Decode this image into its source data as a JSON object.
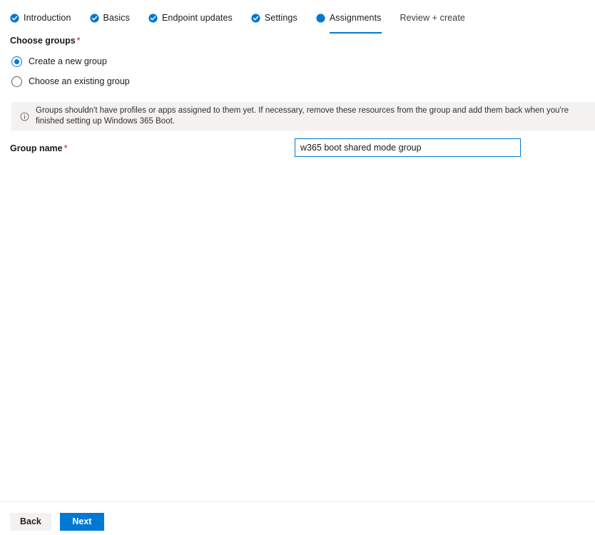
{
  "wizard": {
    "tabs": [
      {
        "label": "Introduction",
        "icon": "check-circle-icon",
        "state": "completed"
      },
      {
        "label": "Basics",
        "icon": "check-circle-icon",
        "state": "completed"
      },
      {
        "label": "Endpoint updates",
        "icon": "check-circle-icon",
        "state": "completed"
      },
      {
        "label": "Settings",
        "icon": "check-circle-icon",
        "state": "completed"
      },
      {
        "label": "Assignments",
        "icon": "filled-circle-icon",
        "state": "current"
      },
      {
        "label": "Review + create",
        "icon": "none",
        "state": "upcoming"
      }
    ]
  },
  "form": {
    "choose_groups": {
      "label": "Choose groups",
      "required_marker": "*",
      "options": [
        {
          "label": "Create a new group",
          "selected": true
        },
        {
          "label": "Choose an existing group",
          "selected": false
        }
      ]
    },
    "info_banner": {
      "icon": "info-circle-icon",
      "text": "Groups shouldn't have profiles or apps assigned to them yet. If necessary, remove these resources from the group and add them back when you're finished setting up Windows 365 Boot."
    },
    "group_name": {
      "label": "Group name",
      "required_marker": "*",
      "value": "w365 boot shared mode group",
      "placeholder": ""
    }
  },
  "footer": {
    "back_label": "Back",
    "next_label": "Next"
  },
  "colors": {
    "accent": "#0078d4",
    "required": "#a4262c",
    "banner_bg": "#f3f2f1",
    "secondary_button_bg": "#f3f2f1",
    "text": "#1b1a19"
  }
}
